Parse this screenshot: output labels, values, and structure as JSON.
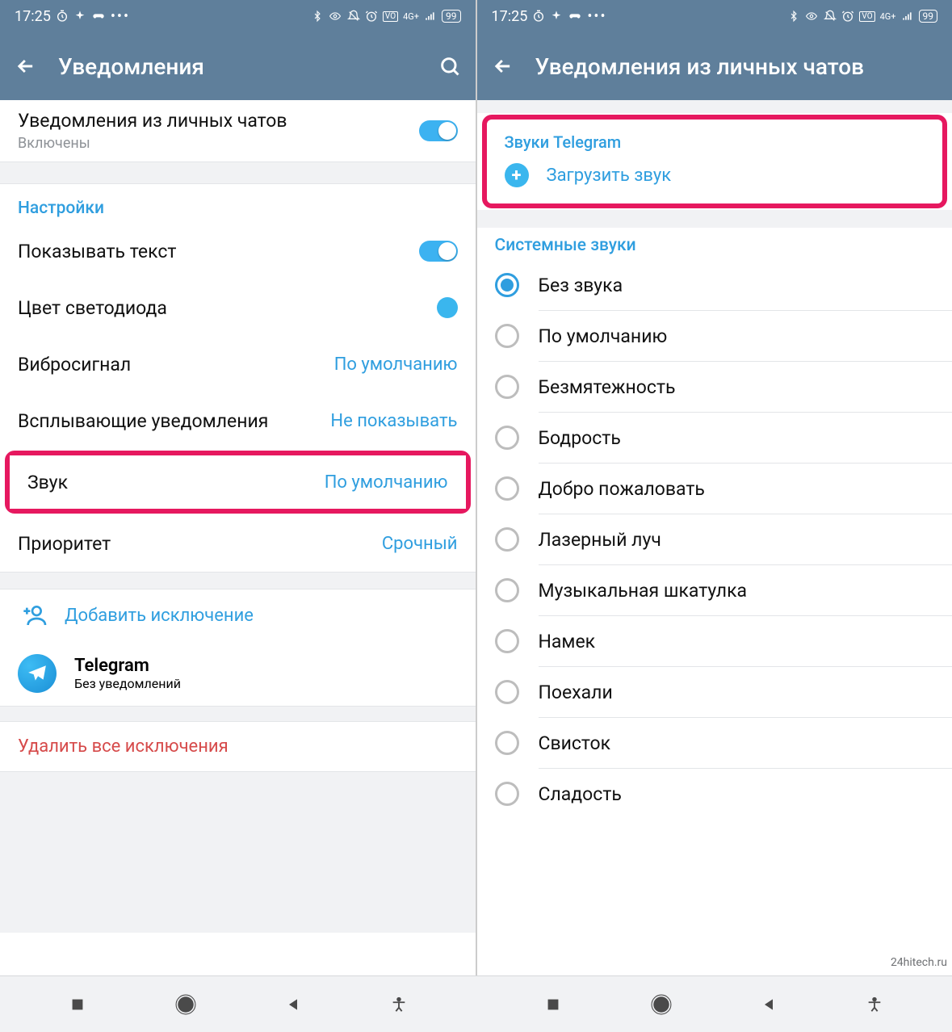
{
  "status": {
    "time": "17:25",
    "battery": "99"
  },
  "left": {
    "title": "Уведомления",
    "private_chats": {
      "label": "Уведомления из личных чатов",
      "sub": "Включены"
    },
    "settings_header": "Настройки",
    "rows": {
      "show_text": "Показывать текст",
      "led": "Цвет светодиода",
      "vibrate": {
        "label": "Вибросигнал",
        "value": "По умолчанию"
      },
      "popup": {
        "label": "Всплывающие уведомления",
        "value": "Не показывать"
      },
      "sound": {
        "label": "Звук",
        "value": "По умолчанию"
      },
      "priority": {
        "label": "Приоритет",
        "value": "Срочный"
      }
    },
    "add_exception": "Добавить исключение",
    "telegram": {
      "name": "Telegram",
      "sub": "Без уведомлений"
    },
    "delete_all": "Удалить все исключения"
  },
  "right": {
    "title": "Уведомления из личных чатов",
    "tg_sounds": "Звуки Telegram",
    "upload": "Загрузить звук",
    "sys_sounds": "Системные звуки",
    "sounds": [
      "Без звука",
      "По умолчанию",
      "Безмятежность",
      "Бодрость",
      "Добро пожаловать",
      "Лазерный луч",
      "Музыкальная шкатулка",
      "Намек",
      "Поехали",
      "Свисток",
      "Сладость"
    ],
    "selected_index": 0
  },
  "watermark": "24hitech.ru"
}
